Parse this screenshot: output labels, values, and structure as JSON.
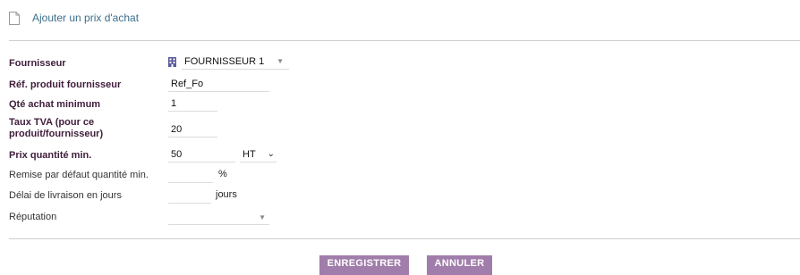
{
  "header": {
    "title": "Ajouter un prix d'achat",
    "icon": "document-icon"
  },
  "form": {
    "supplier": {
      "label": "Fournisseur",
      "value": "FOURNISSEUR 1",
      "icon": "building-icon"
    },
    "ref": {
      "label": "Réf. produit fournisseur",
      "value": "Ref_Fo"
    },
    "min_qty": {
      "label": "Qté achat minimum",
      "value": "1"
    },
    "vat": {
      "label_line1": "Taux TVA (pour ce",
      "label_line2": "produit/fournisseur)",
      "value": "20"
    },
    "price": {
      "label": "Prix quantité min.",
      "value": "50",
      "tax_mode": "HT"
    },
    "discount": {
      "label": "Remise par défaut quantité min.",
      "value": "",
      "unit": "%"
    },
    "delay": {
      "label": "Délai de livraison en jours",
      "value": "",
      "unit": "jours"
    },
    "reputation": {
      "label": "Réputation",
      "value": ""
    }
  },
  "buttons": {
    "save": "ENREGISTRER",
    "cancel": "ANNULER"
  },
  "colors": {
    "accent": "#a07daa",
    "title": "#3c6e8b",
    "label_required": "#3f1d3b"
  }
}
